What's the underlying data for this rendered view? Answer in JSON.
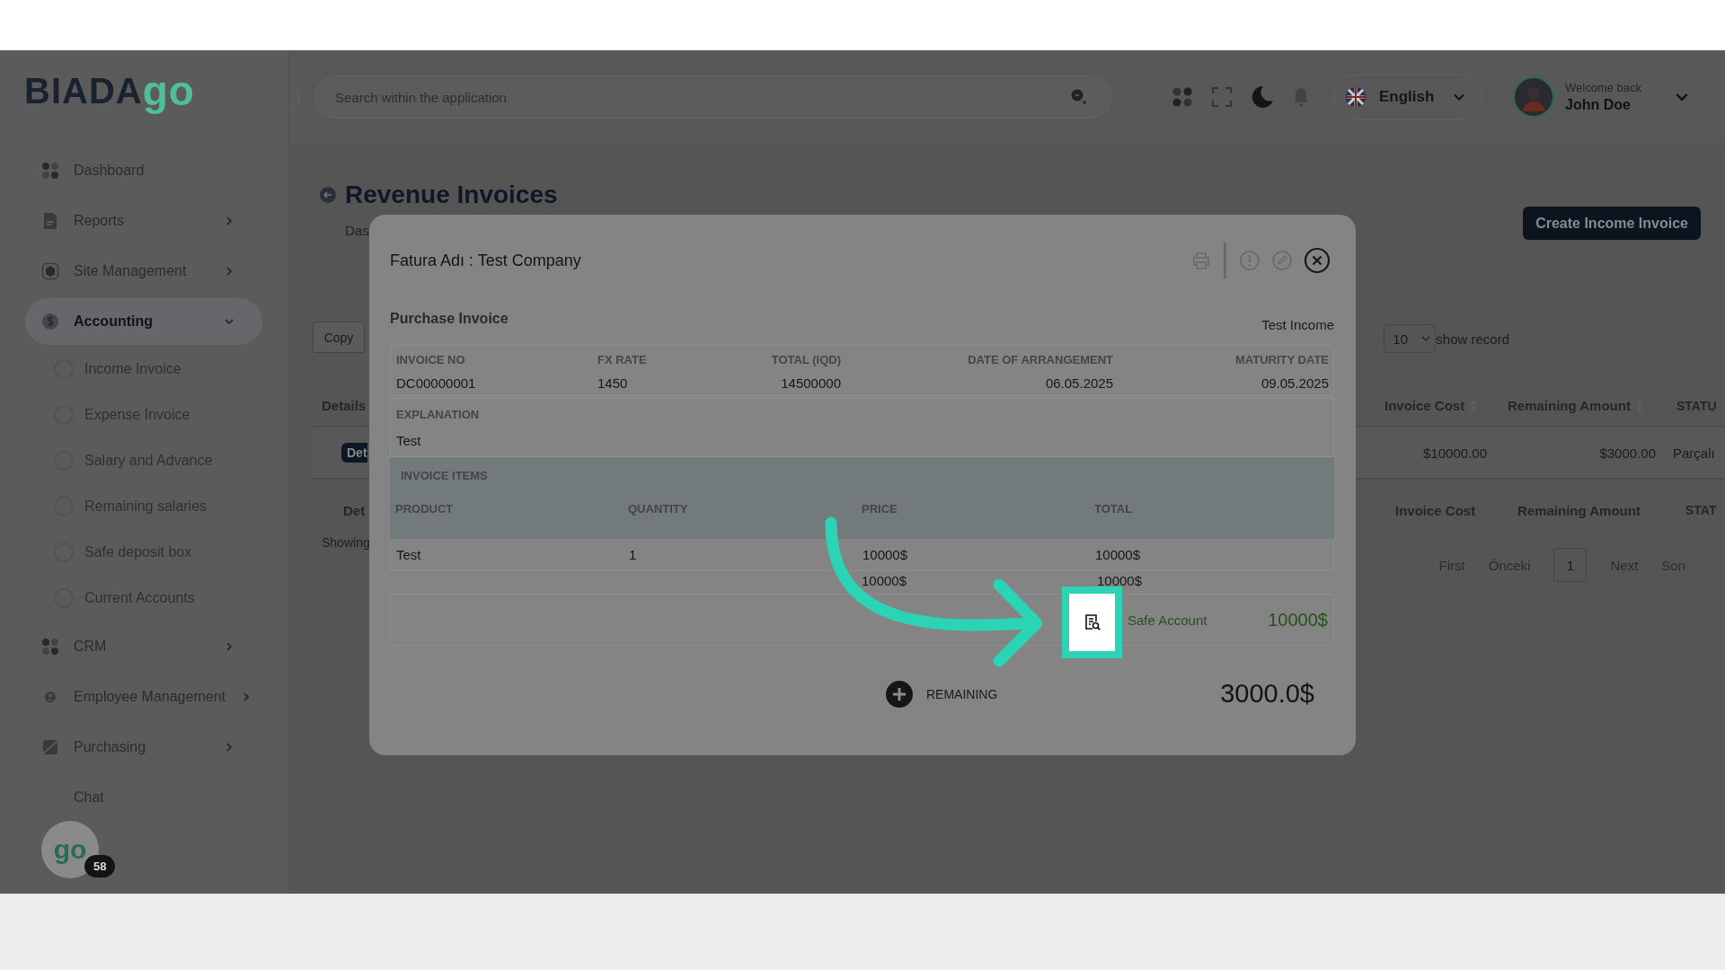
{
  "logo": {
    "text": "BIADA",
    "accent": "go"
  },
  "sidebar": {
    "items": [
      {
        "label": "Dashboard",
        "selected": false
      },
      {
        "label": "Reports",
        "expanded": false,
        "selected": false
      },
      {
        "label": "Site Management",
        "expanded": false,
        "selected": false
      },
      {
        "label": "Accounting",
        "expanded": true,
        "selected": true,
        "children": [
          {
            "label": "Income Invoice",
            "selected": false
          },
          {
            "label": "Expense Invoice",
            "selected": false
          },
          {
            "label": "Salary and Advance",
            "selected": false
          },
          {
            "label": "Remaining salaries",
            "selected": false
          },
          {
            "label": "Safe deposit box",
            "selected": false
          },
          {
            "label": "Current Accounts",
            "selected": false
          }
        ]
      },
      {
        "label": "CRM",
        "expanded": false,
        "selected": false
      },
      {
        "label": "Employee Management",
        "expanded": false,
        "selected": false
      },
      {
        "label": "Purchasing",
        "expanded": false,
        "selected": false
      },
      {
        "label": "Chat",
        "selected": false
      }
    ]
  },
  "chat_widget": {
    "text": "go",
    "badge": "58"
  },
  "header": {
    "search": {
      "placeholder": "Search within the application"
    },
    "language": "English",
    "welcome": "Welcome back",
    "user": "John Doe"
  },
  "page": {
    "title": "Revenue Invoices",
    "breadcrumb": "Das",
    "create_button": "Create Income Invoice",
    "copy_button": "Copy",
    "page_size": "10",
    "page_size_label": "show record",
    "table": {
      "columns": [
        {
          "label": "Details",
          "sortable": false
        },
        {
          "label": "Invoice Cost",
          "sortable": true
        },
        {
          "label": "Remaining Amount",
          "sortable": true
        },
        {
          "label": "STATU",
          "sortable": false
        }
      ],
      "rows": [
        [
          "Det",
          "$10000.00",
          "$3000.00",
          "Parçalı"
        ]
      ],
      "footer": [
        "Det",
        "Invoice Cost",
        "Remaining Amount",
        "STAT"
      ]
    },
    "showing": "Showing",
    "pagination": [
      {
        "label": "First",
        "selected": false,
        "disabled": true
      },
      {
        "label": "Önceki",
        "selected": false,
        "disabled": true
      },
      {
        "label": "1",
        "selected": true,
        "disabled": false
      },
      {
        "label": "Next",
        "selected": false,
        "disabled": true
      },
      {
        "label": "Son",
        "selected": false,
        "disabled": true
      }
    ]
  },
  "modal": {
    "title": "Fatura Adı : Test Company",
    "section": "Purchase Invoice",
    "type_label": "Test Income",
    "info_columns": [
      "INVOICE NO",
      "FX RATE",
      "TOTAL (IQD)",
      "DATE OF ARRANGEMENT",
      "MATURITY DATE"
    ],
    "info_values": [
      "DC00000001",
      "1450",
      "14500000",
      "06.05.2025",
      "09.05.2025"
    ],
    "explanation_label": "EXPLANATION",
    "explanation": "Test",
    "items_title": "INVOICE ITEMS",
    "items_columns": [
      "PRODUCT",
      "QUANTITY",
      "PRICE",
      "TOTAL"
    ],
    "items_rows": [
      [
        "Test",
        "1",
        "10000$",
        "10000$"
      ]
    ],
    "subtotals": [
      "10000$",
      "10000$"
    ],
    "payments": [
      {
        "label": "Safe Account",
        "amount": "10000$"
      }
    ],
    "remaining_label": "REMAINING",
    "remaining": "3000.0$"
  }
}
